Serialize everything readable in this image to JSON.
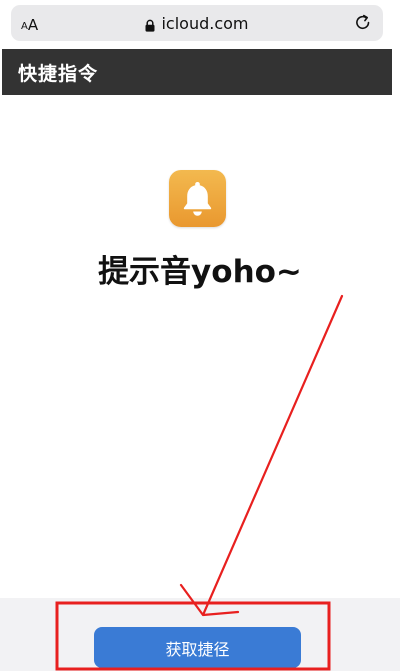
{
  "browser": {
    "text_size_small": "A",
    "text_size_big": "A",
    "url": "icloud.com"
  },
  "header": {
    "title": "快捷指令"
  },
  "shortcut": {
    "name": "提示音yoho~",
    "icon": "bell-icon",
    "icon_gradient": [
      "#f3b94f",
      "#e9982f"
    ]
  },
  "actions": {
    "get_shortcut_label": "获取捷径"
  },
  "colors": {
    "header_bg": "#333333",
    "button_bg": "#3a7bd5",
    "annotation": "#e8201f"
  }
}
